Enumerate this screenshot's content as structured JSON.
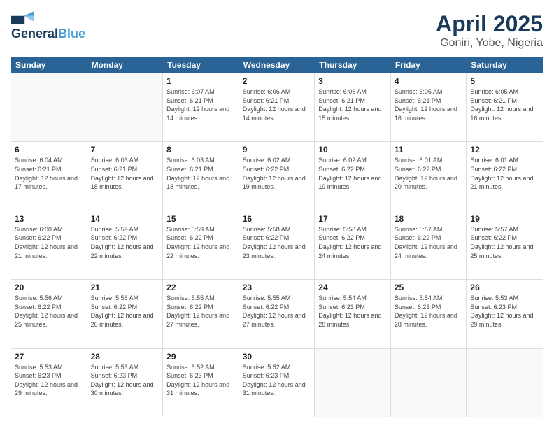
{
  "logo": {
    "general": "General",
    "blue": "Blue"
  },
  "title": "April 2025",
  "subtitle": "Goniri, Yobe, Nigeria",
  "days": [
    "Sunday",
    "Monday",
    "Tuesday",
    "Wednesday",
    "Thursday",
    "Friday",
    "Saturday"
  ],
  "weeks": [
    [
      {
        "day": "",
        "info": ""
      },
      {
        "day": "",
        "info": ""
      },
      {
        "day": "1",
        "info": "Sunrise: 6:07 AM\nSunset: 6:21 PM\nDaylight: 12 hours and 14 minutes."
      },
      {
        "day": "2",
        "info": "Sunrise: 6:06 AM\nSunset: 6:21 PM\nDaylight: 12 hours and 14 minutes."
      },
      {
        "day": "3",
        "info": "Sunrise: 6:06 AM\nSunset: 6:21 PM\nDaylight: 12 hours and 15 minutes."
      },
      {
        "day": "4",
        "info": "Sunrise: 6:05 AM\nSunset: 6:21 PM\nDaylight: 12 hours and 16 minutes."
      },
      {
        "day": "5",
        "info": "Sunrise: 6:05 AM\nSunset: 6:21 PM\nDaylight: 12 hours and 16 minutes."
      }
    ],
    [
      {
        "day": "6",
        "info": "Sunrise: 6:04 AM\nSunset: 6:21 PM\nDaylight: 12 hours and 17 minutes."
      },
      {
        "day": "7",
        "info": "Sunrise: 6:03 AM\nSunset: 6:21 PM\nDaylight: 12 hours and 18 minutes."
      },
      {
        "day": "8",
        "info": "Sunrise: 6:03 AM\nSunset: 6:21 PM\nDaylight: 12 hours and 18 minutes."
      },
      {
        "day": "9",
        "info": "Sunrise: 6:02 AM\nSunset: 6:22 PM\nDaylight: 12 hours and 19 minutes."
      },
      {
        "day": "10",
        "info": "Sunrise: 6:02 AM\nSunset: 6:22 PM\nDaylight: 12 hours and 19 minutes."
      },
      {
        "day": "11",
        "info": "Sunrise: 6:01 AM\nSunset: 6:22 PM\nDaylight: 12 hours and 20 minutes."
      },
      {
        "day": "12",
        "info": "Sunrise: 6:01 AM\nSunset: 6:22 PM\nDaylight: 12 hours and 21 minutes."
      }
    ],
    [
      {
        "day": "13",
        "info": "Sunrise: 6:00 AM\nSunset: 6:22 PM\nDaylight: 12 hours and 21 minutes."
      },
      {
        "day": "14",
        "info": "Sunrise: 5:59 AM\nSunset: 6:22 PM\nDaylight: 12 hours and 22 minutes."
      },
      {
        "day": "15",
        "info": "Sunrise: 5:59 AM\nSunset: 6:22 PM\nDaylight: 12 hours and 22 minutes."
      },
      {
        "day": "16",
        "info": "Sunrise: 5:58 AM\nSunset: 6:22 PM\nDaylight: 12 hours and 23 minutes."
      },
      {
        "day": "17",
        "info": "Sunrise: 5:58 AM\nSunset: 6:22 PM\nDaylight: 12 hours and 24 minutes."
      },
      {
        "day": "18",
        "info": "Sunrise: 5:57 AM\nSunset: 6:22 PM\nDaylight: 12 hours and 24 minutes."
      },
      {
        "day": "19",
        "info": "Sunrise: 5:57 AM\nSunset: 6:22 PM\nDaylight: 12 hours and 25 minutes."
      }
    ],
    [
      {
        "day": "20",
        "info": "Sunrise: 5:56 AM\nSunset: 6:22 PM\nDaylight: 12 hours and 25 minutes."
      },
      {
        "day": "21",
        "info": "Sunrise: 5:56 AM\nSunset: 6:22 PM\nDaylight: 12 hours and 26 minutes."
      },
      {
        "day": "22",
        "info": "Sunrise: 5:55 AM\nSunset: 6:22 PM\nDaylight: 12 hours and 27 minutes."
      },
      {
        "day": "23",
        "info": "Sunrise: 5:55 AM\nSunset: 6:22 PM\nDaylight: 12 hours and 27 minutes."
      },
      {
        "day": "24",
        "info": "Sunrise: 5:54 AM\nSunset: 6:23 PM\nDaylight: 12 hours and 28 minutes."
      },
      {
        "day": "25",
        "info": "Sunrise: 5:54 AM\nSunset: 6:23 PM\nDaylight: 12 hours and 28 minutes."
      },
      {
        "day": "26",
        "info": "Sunrise: 5:53 AM\nSunset: 6:23 PM\nDaylight: 12 hours and 29 minutes."
      }
    ],
    [
      {
        "day": "27",
        "info": "Sunrise: 5:53 AM\nSunset: 6:23 PM\nDaylight: 12 hours and 29 minutes."
      },
      {
        "day": "28",
        "info": "Sunrise: 5:53 AM\nSunset: 6:23 PM\nDaylight: 12 hours and 30 minutes."
      },
      {
        "day": "29",
        "info": "Sunrise: 5:52 AM\nSunset: 6:23 PM\nDaylight: 12 hours and 31 minutes."
      },
      {
        "day": "30",
        "info": "Sunrise: 5:52 AM\nSunset: 6:23 PM\nDaylight: 12 hours and 31 minutes."
      },
      {
        "day": "",
        "info": ""
      },
      {
        "day": "",
        "info": ""
      },
      {
        "day": "",
        "info": ""
      }
    ]
  ]
}
